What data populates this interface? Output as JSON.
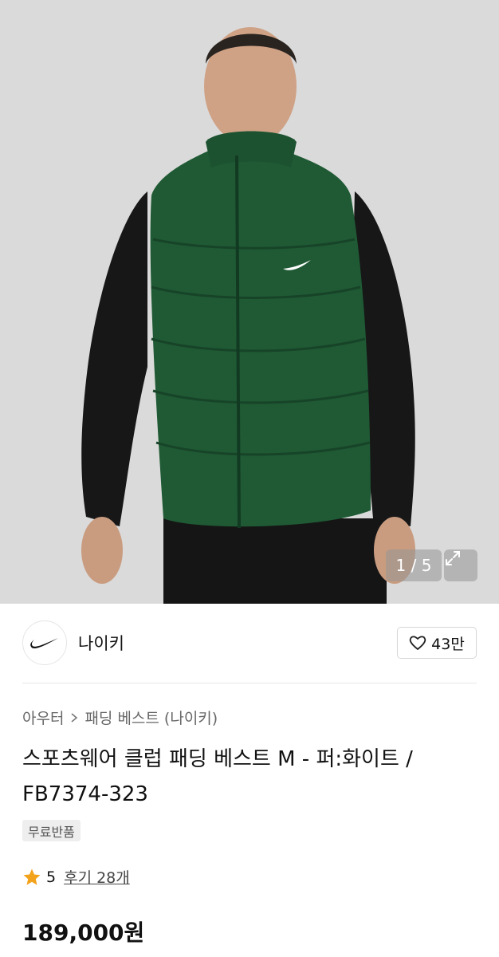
{
  "gallery": {
    "counter": "1 / 5"
  },
  "brand": {
    "name": "나이키",
    "like_count": "43만"
  },
  "breadcrumb": {
    "category": "아우터",
    "subcategory": "패딩 베스트 (나이키)"
  },
  "product": {
    "title": "스포츠웨어 클럽 패딩 베스트 M - 퍼:화이트 / FB7374-323",
    "badge": "무료반품",
    "rating": "5",
    "reviews": "후기 28개",
    "price": "189,000원"
  },
  "colors": {
    "vest": "#1f5a34",
    "sleeves": "#161616",
    "star": "#f2a21b"
  },
  "icons": [
    "heart-icon",
    "expand-icon",
    "chevron-right-icon",
    "star-icon",
    "swoosh-logo"
  ]
}
